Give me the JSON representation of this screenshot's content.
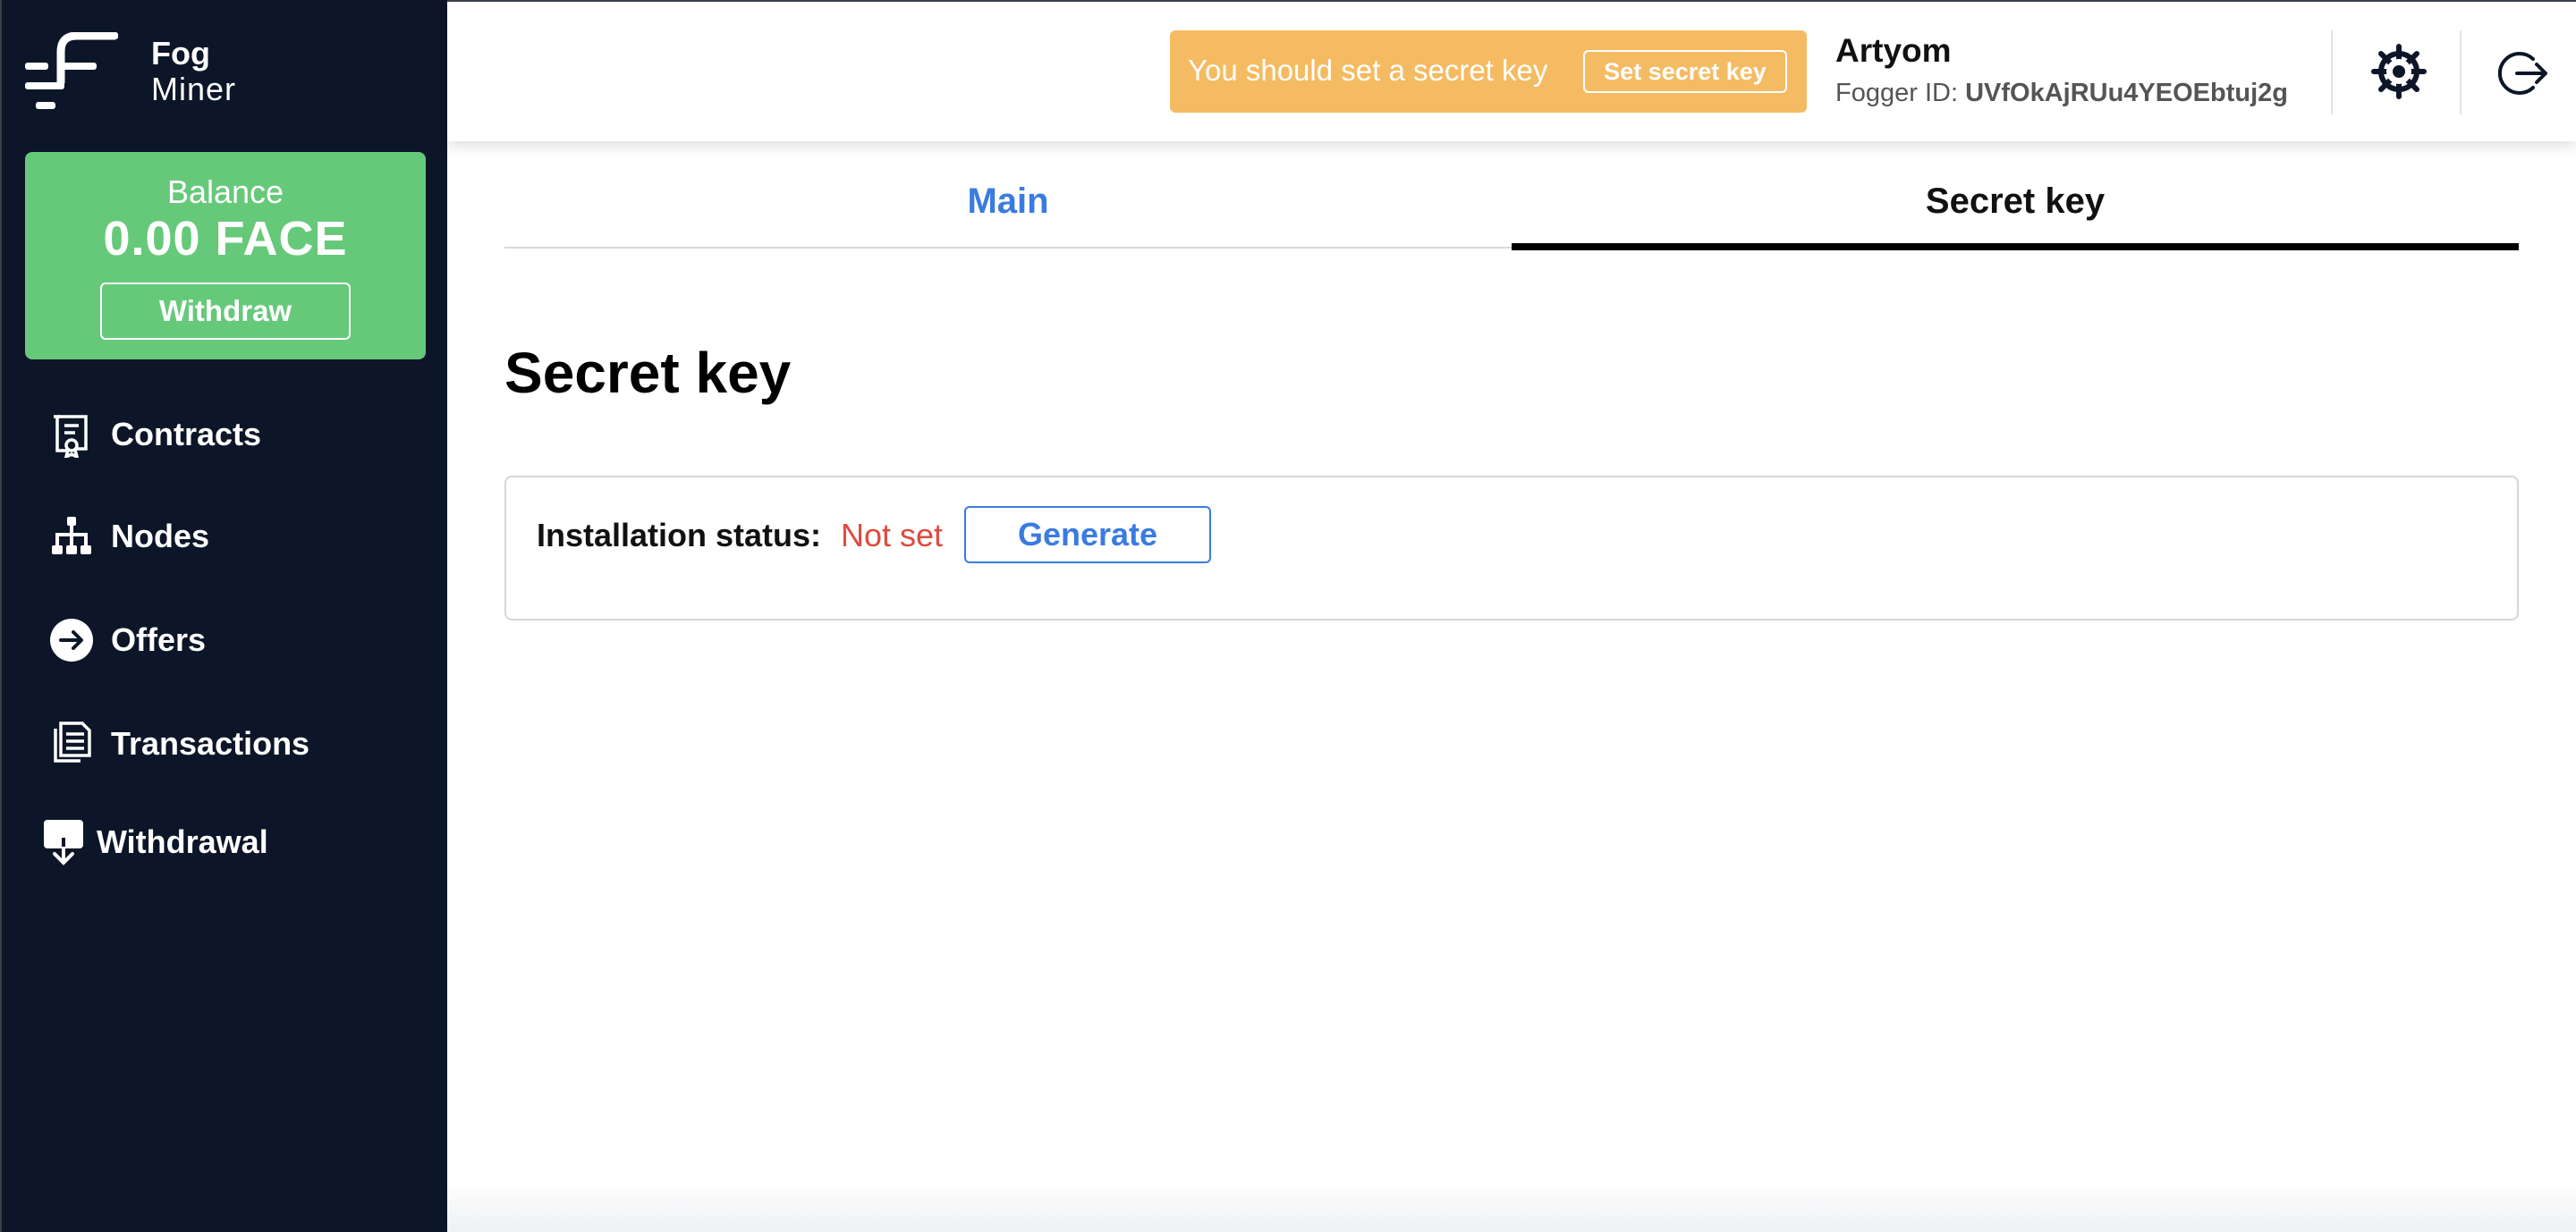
{
  "brand": {
    "line1": "Fog",
    "line2": "Miner"
  },
  "balance": {
    "label": "Balance",
    "amount": "0.00 FACE",
    "withdraw_label": "Withdraw"
  },
  "sidebar": {
    "items": [
      {
        "label": "Contracts",
        "icon": "contract-icon"
      },
      {
        "label": "Nodes",
        "icon": "nodes-icon"
      },
      {
        "label": "Offers",
        "icon": "arrow-right-circle-icon"
      },
      {
        "label": "Transactions",
        "icon": "documents-icon"
      },
      {
        "label": "Withdrawal",
        "icon": "download-icon"
      }
    ]
  },
  "header": {
    "alert_message": "You should set a secret key",
    "alert_button": "Set secret key",
    "user_name": "Artyom",
    "fogger_id_label": "Fogger ID:",
    "fogger_id_value": "UVfOkAjRUu4YEOEbtuj2g"
  },
  "tabs": [
    {
      "label": "Main",
      "active": false
    },
    {
      "label": "Secret key",
      "active": true
    }
  ],
  "main": {
    "title": "Secret key",
    "status_label": "Installation status:",
    "status_value": "Not set",
    "generate_label": "Generate"
  },
  "colors": {
    "sidebar_bg": "#0c1628",
    "balance_bg": "#66c97a",
    "alert_bg": "#f5bb62",
    "accent_blue": "#3a7be0",
    "status_red": "#e04a3e"
  }
}
